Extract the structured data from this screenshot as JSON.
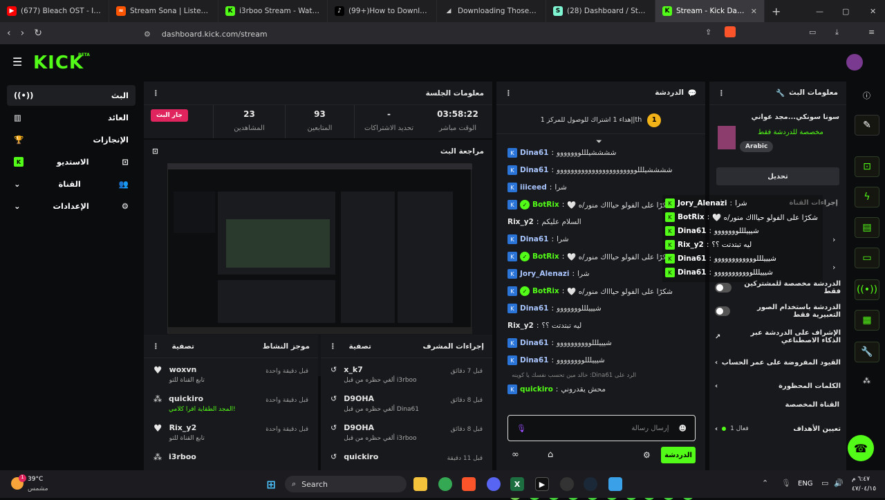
{
  "browser": {
    "tabs": [
      {
        "title": "(677) Bleach OST - Invasion",
        "icon": "youtube-icon",
        "color": "#ff0000"
      },
      {
        "title": "Stream Sona | Listen to to m",
        "icon": "soundcloud-icon",
        "color": "#ff5500"
      },
      {
        "title": "i3rboo Stream - Watch i",
        "icon": "kick-icon",
        "color": "#53fc18"
      },
      {
        "title": "(99+)How to Download Fre",
        "icon": "tiktok-icon",
        "color": "#ffffff"
      },
      {
        "title": "Downloading Those Nights",
        "icon": "page-icon",
        "color": "#cccccc"
      },
      {
        "title": "(28) Dashboard / Streamlab",
        "icon": "streamlabs-icon",
        "color": "#80f5d2"
      },
      {
        "title": "Stream - Kick Dashb",
        "icon": "kick-icon",
        "color": "#53fc18"
      }
    ],
    "url": "dashboard.kick.com/stream"
  },
  "brand": {
    "logo": "KICK",
    "beta": "BETA",
    "accent": "#53fc18"
  },
  "sidebar": {
    "items": [
      {
        "label": "البث",
        "icon": "live-icon"
      },
      {
        "label": "العائد",
        "icon": "revenue-icon"
      },
      {
        "label": "الإنجازات",
        "icon": "trophy-icon"
      },
      {
        "label": "الاستديو",
        "icon": "studio-icon"
      },
      {
        "label": "القناة",
        "icon": "chevron-down-icon"
      },
      {
        "label": "الإعدادات",
        "icon": "chevron-down-icon"
      }
    ]
  },
  "session": {
    "title": "معلومات الجلسة",
    "live_badge": "جار البث",
    "stats": [
      {
        "value": "23",
        "label": "المشاهدين"
      },
      {
        "value": "93",
        "label": "المتابعين"
      },
      {
        "value": "-",
        "label": "تحديد الاشتراكات"
      },
      {
        "value": "03:58:22",
        "label": "الوقت مباشر"
      }
    ]
  },
  "preview": {
    "title": "مراجعة البث"
  },
  "activity": {
    "title": "موجز النشاط",
    "filter": "تصفية",
    "items": [
      {
        "name": "woxvn",
        "sub": "تابع القناة للتو",
        "time": "قبل دقيقة واحدة",
        "icon": "heart-icon"
      },
      {
        "name": "quickiro",
        "sub": "!المجد الطقاية اقرا كلامي",
        "time": "قبل دقيقة واحدة",
        "icon": "users-icon"
      },
      {
        "name": "Rix_y2",
        "sub": "تابع القناة للتو",
        "time": "قبل دقيقة واحدة",
        "icon": "heart-icon"
      },
      {
        "name": "i3rboo",
        "sub": "",
        "time": "",
        "icon": "users-icon"
      }
    ]
  },
  "modactions": {
    "title": "إجراءات المشرف",
    "filter": "تصفية",
    "items": [
      {
        "name": "x_k7",
        "sub": "i3rboo ألغي حظره من قبل",
        "time": "قبل 7 دقائق"
      },
      {
        "name": "D9OHA",
        "sub": "Dina61 ألغي حظره من قبل",
        "time": "قبل 8 دقائق"
      },
      {
        "name": "D9OHA",
        "sub": "i3rboo ألغي حظره من قبل",
        "time": "قبل 8 دقائق"
      },
      {
        "name": "quickiro",
        "sub": "",
        "time": "قبل 11 دقيقة"
      }
    ]
  },
  "chat": {
    "title": "الدردشة",
    "pinned": "إهداء 1 اشتراك للوصول للمركز 1|th",
    "pinned_badge": "1",
    "messages": [
      {
        "user": "Dina61",
        "text": "ششششيلللووووووو",
        "badge": "blue"
      },
      {
        "user": "Dina61",
        "text": "ششششيلللووووووووووووووووووووووو",
        "badge": "blue"
      },
      {
        "user": "iiiceed",
        "text": "شرا",
        "badge": "blue"
      },
      {
        "user": "BotRix",
        "text": "شكرًا على الفولو حياااك منور/ه 🤍",
        "badge": "bot"
      },
      {
        "user": "Rix_y2",
        "text": "السلام عليكم",
        "badge": "none"
      },
      {
        "user": "Dina61",
        "text": "شرا",
        "badge": "blue"
      },
      {
        "user": "BotRix",
        "text": "شكرًا على الفولو حياااك منور/ه 🤍",
        "badge": "bot"
      },
      {
        "user": "Jory_Alenazi",
        "text": "شرا",
        "badge": "blue"
      },
      {
        "user": "BotRix",
        "text": "شكرًا على الفولو حياااك منور/ه 🤍",
        "badge": "bot"
      },
      {
        "user": "Dina61",
        "text": "شيييلللووووووو",
        "badge": "blue"
      },
      {
        "user": "Rix_y2",
        "text": "ليه تبتدتت ؟؟",
        "badge": "none"
      },
      {
        "user": "Dina61",
        "text": "شيييلللوووووووووو",
        "badge": "blue"
      },
      {
        "user": "Dina61",
        "text": "شيييلللوووووووو",
        "badge": "blue"
      }
    ],
    "reply_hint": "الرد على Dina61: خالد مين تحسب نفسك يا كوينه",
    "last": {
      "user": "quickiro",
      "text": "محش يقدروني"
    },
    "input_placeholder": "إرسال رسالة",
    "send": "الدردشة"
  },
  "overlay_chat": [
    {
      "user": "Jory_Alenazi",
      "text": "شرا"
    },
    {
      "user": "BotRix",
      "text": "شكرًا على الفولو حياااك منور/ه 🤍"
    },
    {
      "user": "Dina61",
      "text": "شيييلللووووووو"
    },
    {
      "user": "Rix_y2",
      "text": "ليه تبتدتت ؟؟"
    },
    {
      "user": "Dina61",
      "text": "شيييلللوووووووووووو"
    },
    {
      "user": "Dina61",
      "text": "شيييلللووووووووووو"
    }
  ],
  "streaminfo": {
    "title": "معلومات البث",
    "stream_title": "سونا سونكي...مجد عواني",
    "category": "مخصصة للدردشة فقط",
    "language": "Arabic",
    "edit": "تحديل"
  },
  "chatsettings": {
    "header": "إجراءات القناة",
    "rows": [
      {
        "label": "الدردشة مخصصة للمشتركين فقط",
        "type": "toggle"
      },
      {
        "label": "الدردشة باستخدام الصور التعبيرية فقط",
        "type": "toggle"
      },
      {
        "label": "الإشراف على الدردشة عبر الذكاء الاصطناعي",
        "type": "link"
      },
      {
        "label": "القيود المفروضة على عمر الحساب",
        "type": "chevron"
      },
      {
        "label": "الكلمات المحظورة",
        "type": "chevron"
      }
    ],
    "section": "القناة المخصصة",
    "goal_label": "تعيين الأهداف",
    "goal_status": "فعال 1"
  },
  "taskbar": {
    "weather_temp": "39°C",
    "weather_desc": "مشمس",
    "weather_badge": "1",
    "search": "Search",
    "lang": "ENG",
    "time": "٦:٤٧ م",
    "date": "٤٧/٠٤/١٥"
  }
}
